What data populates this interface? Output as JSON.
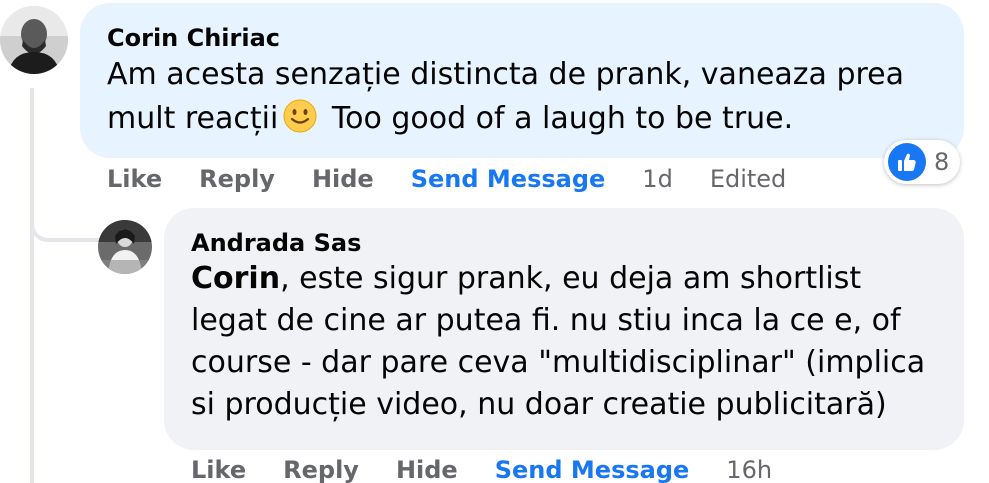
{
  "comments": [
    {
      "author": "Corin Chiriac",
      "text_part1": "Am acesta senzație distincta de prank, vaneaza prea mult reacții",
      "text_part2": " Too good of a laugh to be true.",
      "emoji": "slightly-smiling-face",
      "reaction": {
        "icon": "like-icon",
        "count": "8"
      },
      "actions": {
        "like": "Like",
        "reply": "Reply",
        "hide": "Hide",
        "send_message": "Send Message"
      },
      "time": "1d",
      "edited": "Edited"
    },
    {
      "author": "Andrada Sas",
      "mention": "Corin",
      "text": ", este sigur prank, eu deja am shortlist legat de cine ar putea fi. nu stiu inca la ce e, of course - dar pare ceva \"multidisciplinar\" (implica si producție video, nu doar creatie publicitară)",
      "actions": {
        "like": "Like",
        "reply": "Reply",
        "hide": "Hide",
        "send_message": "Send Message"
      },
      "time": "16h"
    }
  ],
  "colors": {
    "bubble_primary": "#e7f3ff",
    "bubble_secondary": "#f0f2f5",
    "accent": "#1877f2",
    "muted": "#65676b",
    "text": "#050505"
  }
}
